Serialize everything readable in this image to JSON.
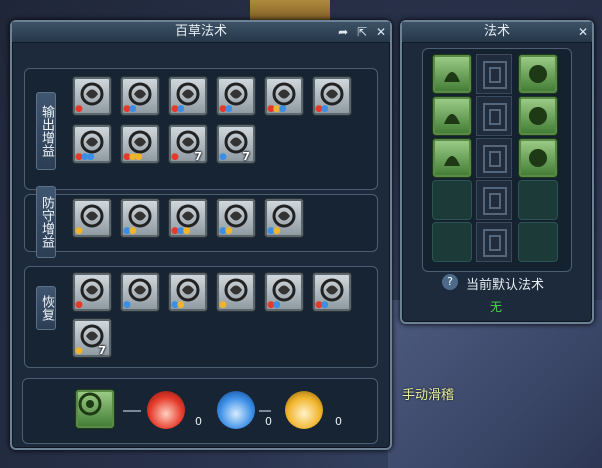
{
  "herb_panel": {
    "title": "百草法术",
    "categories": [
      {
        "label": "输出增益"
      },
      {
        "label": "防守增益"
      },
      {
        "label": "恢复"
      }
    ],
    "output_icons": [
      {
        "icon": "leaf-swirl-icon",
        "drops": "red",
        "count": ""
      },
      {
        "icon": "burst-leaf-icon",
        "drops": "red blue",
        "count": ""
      },
      {
        "icon": "root-splash-icon",
        "drops": "red blue",
        "count": ""
      },
      {
        "icon": "wave-bloom-icon",
        "drops": "red blue",
        "count": ""
      },
      {
        "icon": "comet-swirl-icon",
        "drops": "red yellow blue",
        "count": ""
      },
      {
        "icon": "crown-flower-icon",
        "drops": "red blue",
        "count": ""
      },
      {
        "icon": "sun-flare-icon",
        "drops": "red blue blue",
        "count": ""
      },
      {
        "icon": "vortex-icon",
        "drops": "red yellow yellow",
        "count": ""
      },
      {
        "icon": "spider-bug-icon",
        "drops": "red",
        "count": "7"
      },
      {
        "icon": "bloom-cluster-icon",
        "drops": "blue",
        "count": "7"
      }
    ],
    "defense_icons": [
      {
        "icon": "leaf-shield-icon",
        "drops": "yellow",
        "count": ""
      },
      {
        "icon": "mushroom-cloud-icon",
        "drops": "blue yellow",
        "count": ""
      },
      {
        "icon": "lotus-burst-icon",
        "drops": "red blue yellow",
        "count": ""
      },
      {
        "icon": "splatter-icon",
        "drops": "blue yellow",
        "count": ""
      },
      {
        "icon": "clover-icon",
        "drops": "blue yellow",
        "count": ""
      }
    ],
    "recovery_icons": [
      {
        "icon": "flower-stem-icon",
        "drops": "red",
        "count": ""
      },
      {
        "icon": "petal-scatter-icon",
        "drops": "blue",
        "count": ""
      },
      {
        "icon": "seed-bloom-icon",
        "drops": "blue yellow",
        "count": ""
      },
      {
        "icon": "sprout-icon",
        "drops": "yellow",
        "count": ""
      },
      {
        "icon": "flower-field-icon",
        "drops": "red blue",
        "count": ""
      },
      {
        "icon": "spotted-leaf-icon",
        "drops": "red blue",
        "count": ""
      },
      {
        "icon": "tree-crown-icon",
        "drops": "yellow",
        "count": "7"
      }
    ],
    "bottom": {
      "main_icon": "green-vortex-icon",
      "red_value": "0",
      "blue_value": "0",
      "yellow_value": "0"
    }
  },
  "spell_panel": {
    "title": "法术",
    "left_column": [
      "green-sprout-icon",
      "green-flame-seed-icon",
      "green-droplets-icon",
      "",
      ""
    ],
    "right_column": [
      "green-eye-vortex-icon",
      "green-moon-star-icon",
      "green-spider-icon",
      "",
      ""
    ],
    "help_label": "?",
    "default_label": "当前默认法术",
    "default_value": "无"
  },
  "world": {
    "character_label": "手动滑稽"
  },
  "colors": {
    "drop_red": "#e53a2a",
    "drop_blue": "#3a8ee6",
    "drop_yellow": "#f0b42a",
    "accent_green": "#4bd84b"
  }
}
